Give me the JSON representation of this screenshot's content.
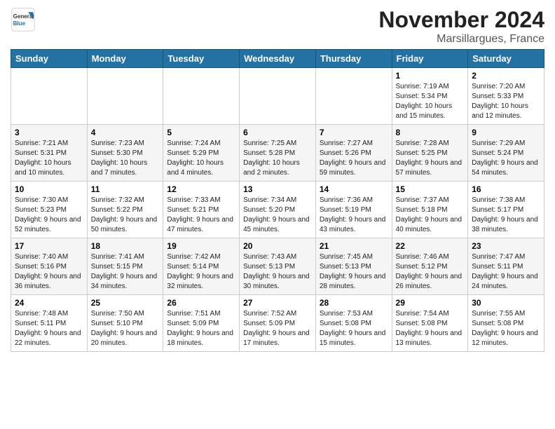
{
  "logo": {
    "general": "General",
    "blue": "Blue"
  },
  "header": {
    "month": "November 2024",
    "location": "Marsillargues, France"
  },
  "weekdays": [
    "Sunday",
    "Monday",
    "Tuesday",
    "Wednesday",
    "Thursday",
    "Friday",
    "Saturday"
  ],
  "weeks": [
    [
      {
        "day": "",
        "info": ""
      },
      {
        "day": "",
        "info": ""
      },
      {
        "day": "",
        "info": ""
      },
      {
        "day": "",
        "info": ""
      },
      {
        "day": "",
        "info": ""
      },
      {
        "day": "1",
        "info": "Sunrise: 7:19 AM\nSunset: 5:34 PM\nDaylight: 10 hours and 15 minutes."
      },
      {
        "day": "2",
        "info": "Sunrise: 7:20 AM\nSunset: 5:33 PM\nDaylight: 10 hours and 12 minutes."
      }
    ],
    [
      {
        "day": "3",
        "info": "Sunrise: 7:21 AM\nSunset: 5:31 PM\nDaylight: 10 hours and 10 minutes."
      },
      {
        "day": "4",
        "info": "Sunrise: 7:23 AM\nSunset: 5:30 PM\nDaylight: 10 hours and 7 minutes."
      },
      {
        "day": "5",
        "info": "Sunrise: 7:24 AM\nSunset: 5:29 PM\nDaylight: 10 hours and 4 minutes."
      },
      {
        "day": "6",
        "info": "Sunrise: 7:25 AM\nSunset: 5:28 PM\nDaylight: 10 hours and 2 minutes."
      },
      {
        "day": "7",
        "info": "Sunrise: 7:27 AM\nSunset: 5:26 PM\nDaylight: 9 hours and 59 minutes."
      },
      {
        "day": "8",
        "info": "Sunrise: 7:28 AM\nSunset: 5:25 PM\nDaylight: 9 hours and 57 minutes."
      },
      {
        "day": "9",
        "info": "Sunrise: 7:29 AM\nSunset: 5:24 PM\nDaylight: 9 hours and 54 minutes."
      }
    ],
    [
      {
        "day": "10",
        "info": "Sunrise: 7:30 AM\nSunset: 5:23 PM\nDaylight: 9 hours and 52 minutes."
      },
      {
        "day": "11",
        "info": "Sunrise: 7:32 AM\nSunset: 5:22 PM\nDaylight: 9 hours and 50 minutes."
      },
      {
        "day": "12",
        "info": "Sunrise: 7:33 AM\nSunset: 5:21 PM\nDaylight: 9 hours and 47 minutes."
      },
      {
        "day": "13",
        "info": "Sunrise: 7:34 AM\nSunset: 5:20 PM\nDaylight: 9 hours and 45 minutes."
      },
      {
        "day": "14",
        "info": "Sunrise: 7:36 AM\nSunset: 5:19 PM\nDaylight: 9 hours and 43 minutes."
      },
      {
        "day": "15",
        "info": "Sunrise: 7:37 AM\nSunset: 5:18 PM\nDaylight: 9 hours and 40 minutes."
      },
      {
        "day": "16",
        "info": "Sunrise: 7:38 AM\nSunset: 5:17 PM\nDaylight: 9 hours and 38 minutes."
      }
    ],
    [
      {
        "day": "17",
        "info": "Sunrise: 7:40 AM\nSunset: 5:16 PM\nDaylight: 9 hours and 36 minutes."
      },
      {
        "day": "18",
        "info": "Sunrise: 7:41 AM\nSunset: 5:15 PM\nDaylight: 9 hours and 34 minutes."
      },
      {
        "day": "19",
        "info": "Sunrise: 7:42 AM\nSunset: 5:14 PM\nDaylight: 9 hours and 32 minutes."
      },
      {
        "day": "20",
        "info": "Sunrise: 7:43 AM\nSunset: 5:13 PM\nDaylight: 9 hours and 30 minutes."
      },
      {
        "day": "21",
        "info": "Sunrise: 7:45 AM\nSunset: 5:13 PM\nDaylight: 9 hours and 28 minutes."
      },
      {
        "day": "22",
        "info": "Sunrise: 7:46 AM\nSunset: 5:12 PM\nDaylight: 9 hours and 26 minutes."
      },
      {
        "day": "23",
        "info": "Sunrise: 7:47 AM\nSunset: 5:11 PM\nDaylight: 9 hours and 24 minutes."
      }
    ],
    [
      {
        "day": "24",
        "info": "Sunrise: 7:48 AM\nSunset: 5:11 PM\nDaylight: 9 hours and 22 minutes."
      },
      {
        "day": "25",
        "info": "Sunrise: 7:50 AM\nSunset: 5:10 PM\nDaylight: 9 hours and 20 minutes."
      },
      {
        "day": "26",
        "info": "Sunrise: 7:51 AM\nSunset: 5:09 PM\nDaylight: 9 hours and 18 minutes."
      },
      {
        "day": "27",
        "info": "Sunrise: 7:52 AM\nSunset: 5:09 PM\nDaylight: 9 hours and 17 minutes."
      },
      {
        "day": "28",
        "info": "Sunrise: 7:53 AM\nSunset: 5:08 PM\nDaylight: 9 hours and 15 minutes."
      },
      {
        "day": "29",
        "info": "Sunrise: 7:54 AM\nSunset: 5:08 PM\nDaylight: 9 hours and 13 minutes."
      },
      {
        "day": "30",
        "info": "Sunrise: 7:55 AM\nSunset: 5:08 PM\nDaylight: 9 hours and 12 minutes."
      }
    ]
  ]
}
